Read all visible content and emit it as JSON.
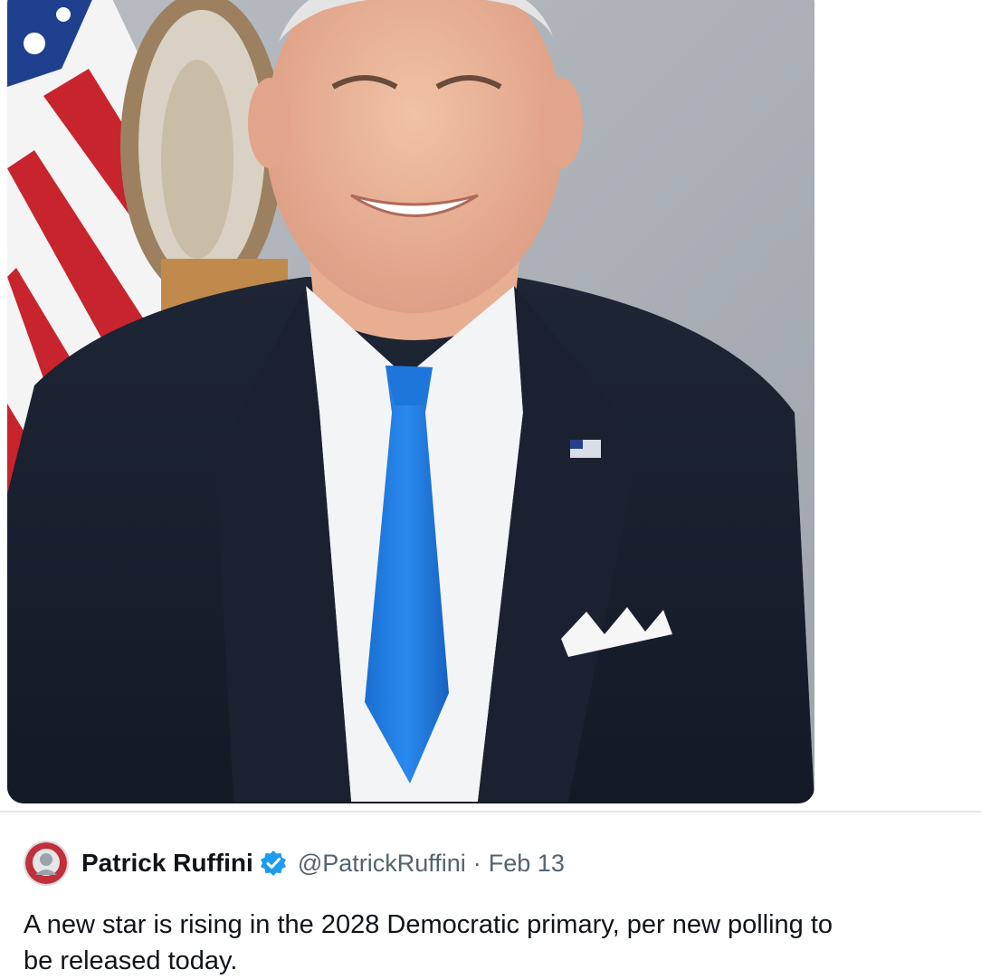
{
  "media": {
    "icon": "portrait-photo"
  },
  "tweet": {
    "display_name": "Patrick Ruffini",
    "verified_icon": "verified-badge-icon",
    "handle": "@PatrickRuffini",
    "separator": "·",
    "date": "Feb 13",
    "text_line_1": "A new star is rising in the 2028 Democratic primary, per new polling to",
    "text_line_2": "be released today."
  },
  "colors": {
    "verified": "#1d9bf0",
    "text": "#0f1419",
    "secondary_text": "#536471"
  }
}
